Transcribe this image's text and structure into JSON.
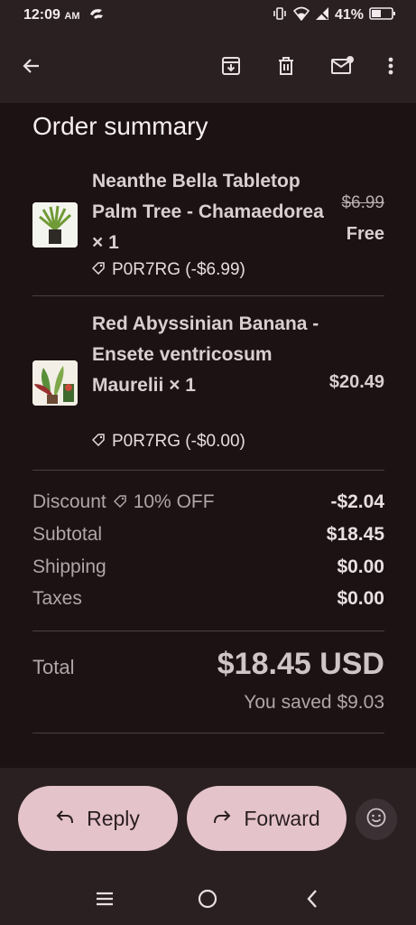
{
  "status": {
    "time": "12:09",
    "ampm": "AM",
    "battery": "41%"
  },
  "appbar": {
    "icons": [
      "back-arrow-icon",
      "archive-icon",
      "delete-icon",
      "mark-unread-icon",
      "more-vert-icon"
    ]
  },
  "order": {
    "title": "Order summary",
    "items": [
      {
        "name": "Neanthe Bella Tabletop Palm Tree - Chamaedorea × 1",
        "code": "P0R7RG (-$6.99)",
        "original_price": "$6.99",
        "price": "Free"
      },
      {
        "name": "Red Abyssinian Banana - Ensete ventricosum Maurelii × 1",
        "code": "P0R7RG (-$0.00)",
        "price": "$20.49"
      }
    ],
    "discount_label": "Discount",
    "discount_tag": "10% OFF",
    "discount_value": "-$2.04",
    "subtotal_label": "Subtotal",
    "subtotal_value": "$18.45",
    "shipping_label": "Shipping",
    "shipping_value": "$0.00",
    "taxes_label": "Taxes",
    "taxes_value": "$0.00",
    "total_label": "Total",
    "total_value": "$18.45 USD",
    "saved_text": "You saved $9.03"
  },
  "actions": {
    "reply_label": "Reply",
    "forward_label": "Forward"
  },
  "colors": {
    "accent_button": "#e4c3cb",
    "background": "#1c1214"
  }
}
